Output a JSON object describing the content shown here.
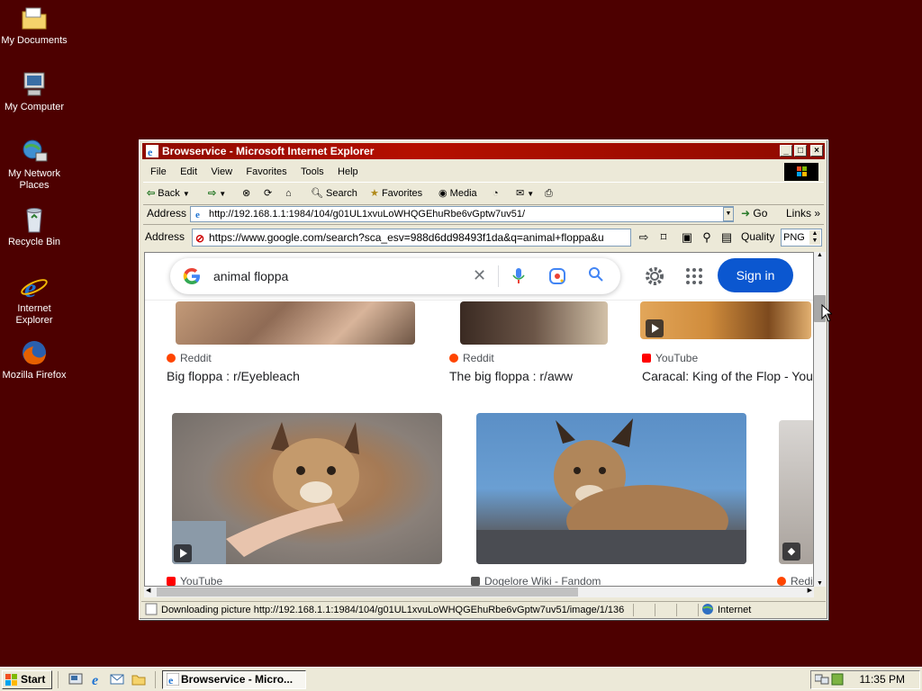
{
  "desktop": {
    "icons": [
      {
        "label": "My Documents"
      },
      {
        "label": "My Computer"
      },
      {
        "label": "My Network Places"
      },
      {
        "label": "Recycle Bin"
      },
      {
        "label": "Internet Explorer"
      },
      {
        "label": "Mozilla Firefox"
      }
    ]
  },
  "window": {
    "title": "Browservice - Microsoft Internet Explorer",
    "menu": [
      "File",
      "Edit",
      "View",
      "Favorites",
      "Tools",
      "Help"
    ],
    "toolbar": {
      "back": "Back",
      "search": "Search",
      "favorites": "Favorites",
      "media": "Media"
    },
    "address_label": "Address",
    "address_value": "http://192.168.1.1:1984/104/g01UL1xvuLoWHQGEhuRbe6vGptw7uv51/",
    "go_label": "Go",
    "links_label": "Links",
    "inner_address_label": "Address",
    "inner_address_value": "https://www.google.com/search?sca_esv=988d6dd98493f1da&q=animal+floppa&u",
    "quality_label": "Quality",
    "quality_value": "PNG",
    "status_text": "Downloading picture http://192.168.1.1:1984/104/g01UL1xvuLoWHQGEhuRbe6vGptw7uv51/image/1/136",
    "status_zone": "Internet"
  },
  "page": {
    "search_query": "animal floppa",
    "signin_label": "Sign in",
    "results": [
      {
        "source": "Reddit",
        "title": "Big floppa : r/Eyebleach",
        "source_color": "#ff4500"
      },
      {
        "source": "Reddit",
        "title": "The big floppa : r/aww",
        "source_color": "#ff4500"
      },
      {
        "source": "YouTube",
        "title": "Caracal: King of the Flop - You",
        "source_color": "#ff0000"
      },
      {
        "source": "YouTube",
        "source_color": "#ff0000"
      },
      {
        "source": "Dogelore Wiki - Fandom",
        "source_color": "#555555"
      },
      {
        "source": "Redi",
        "source_color": "#ff4500"
      }
    ]
  },
  "taskbar": {
    "start_label": "Start",
    "task_label": "Browservice - Micro...",
    "clock": "11:35 PM"
  }
}
